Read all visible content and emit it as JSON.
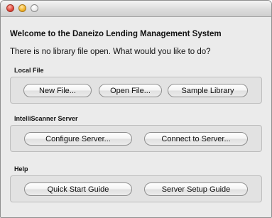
{
  "dialog": {
    "headline": "Welcome to the Daneizo Lending Management System",
    "prompt": "There is no library file open. What would you like to do?"
  },
  "local_file": {
    "label": "Local File",
    "new_file": "New File...",
    "open_file": "Open File...",
    "sample_library": "Sample Library"
  },
  "server": {
    "label": "IntelliScanner Server",
    "configure": "Configure Server...",
    "connect": "Connect to Server..."
  },
  "help": {
    "label": "Help",
    "quick_start": "Quick Start Guide",
    "server_setup": "Server Setup Guide"
  }
}
